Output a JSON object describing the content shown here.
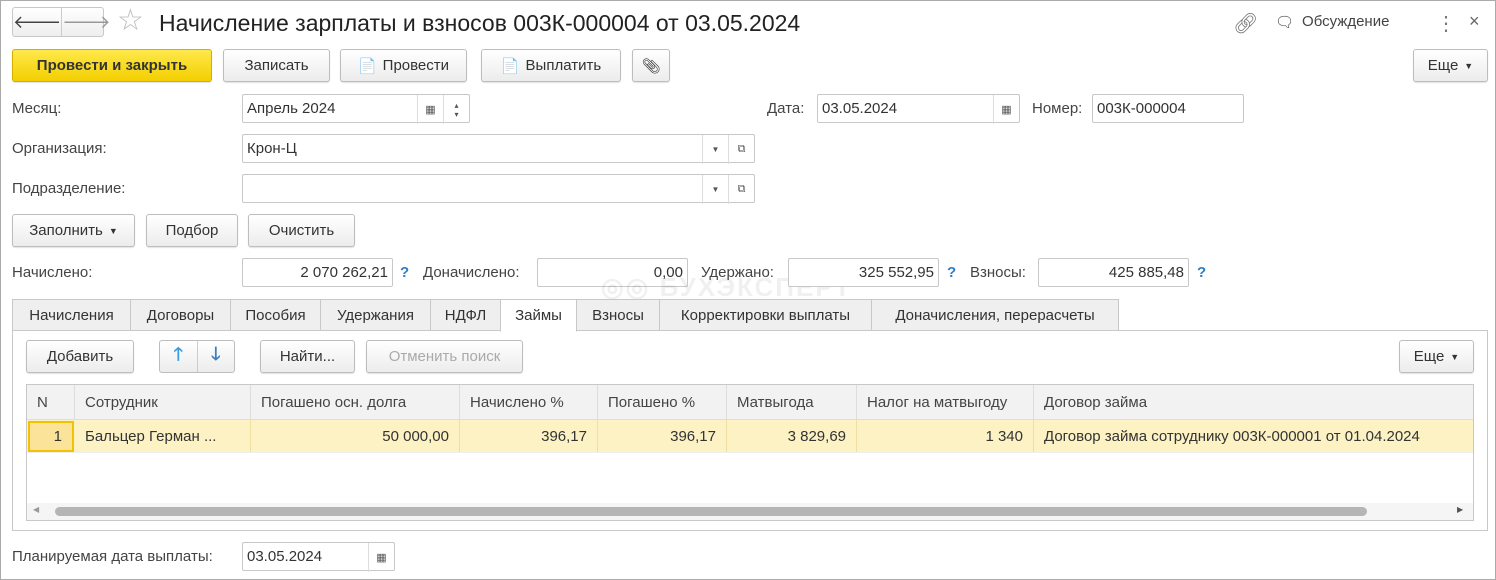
{
  "header": {
    "title": "Начисление зарплаты и взносов 003К-000004 от 03.05.2024",
    "discussion": "Обсуждение"
  },
  "toolbar": {
    "post_close": "Провести и закрыть",
    "save": "Записать",
    "post": "Провести",
    "pay": "Выплатить",
    "more": "Еще"
  },
  "fields": {
    "month_label": "Месяц:",
    "month": "Апрель 2024",
    "date_label": "Дата:",
    "date": "03.05.2024",
    "number_label": "Номер:",
    "number": "003К-000004",
    "org_label": "Организация:",
    "org": "Крон-Ц",
    "dept_label": "Подразделение:",
    "dept": ""
  },
  "fill": {
    "fill": "Заполнить",
    "pick": "Подбор",
    "clear": "Очистить"
  },
  "totals": {
    "accrued_label": "Начислено:",
    "accrued": "2 070 262,21",
    "extra_label": "Доначислено:",
    "extra": "0,00",
    "withheld_label": "Удержано:",
    "withheld": "325 552,95",
    "contrib_label": "Взносы:",
    "contrib": "425 885,48",
    "help": "?"
  },
  "watermark": "БУХЭКСПЕРТ",
  "tabs": [
    "Начисления",
    "Договоры",
    "Пособия",
    "Удержания",
    "НДФЛ",
    "Займы",
    "Взносы",
    "Корректировки выплаты",
    "Доначисления, перерасчеты"
  ],
  "active_tab": "Займы",
  "tab_toolbar": {
    "add": "Добавить",
    "find": "Найти...",
    "cancel_search": "Отменить поиск",
    "more": "Еще"
  },
  "table": {
    "columns": [
      "N",
      "Сотрудник",
      "Погашено осн. долга",
      "Начислено %",
      "Погашено %",
      "Матвыгода",
      "Налог на матвыгоду",
      "Договор займа"
    ],
    "rows": [
      [
        "1",
        "Бальцер Герман ...",
        "50 000,00",
        "396,17",
        "396,17",
        "3 829,69",
        "1 340",
        "Договор займа сотруднику 003К-000001 от 01.04.2024"
      ]
    ]
  },
  "footer": {
    "pay_date_label": "Планируемая дата выплаты:",
    "pay_date": "03.05.2024"
  },
  "colors": {
    "primary": "#f3cf00",
    "selected_row": "#fdf2c4",
    "help": "#2c7fc7"
  }
}
